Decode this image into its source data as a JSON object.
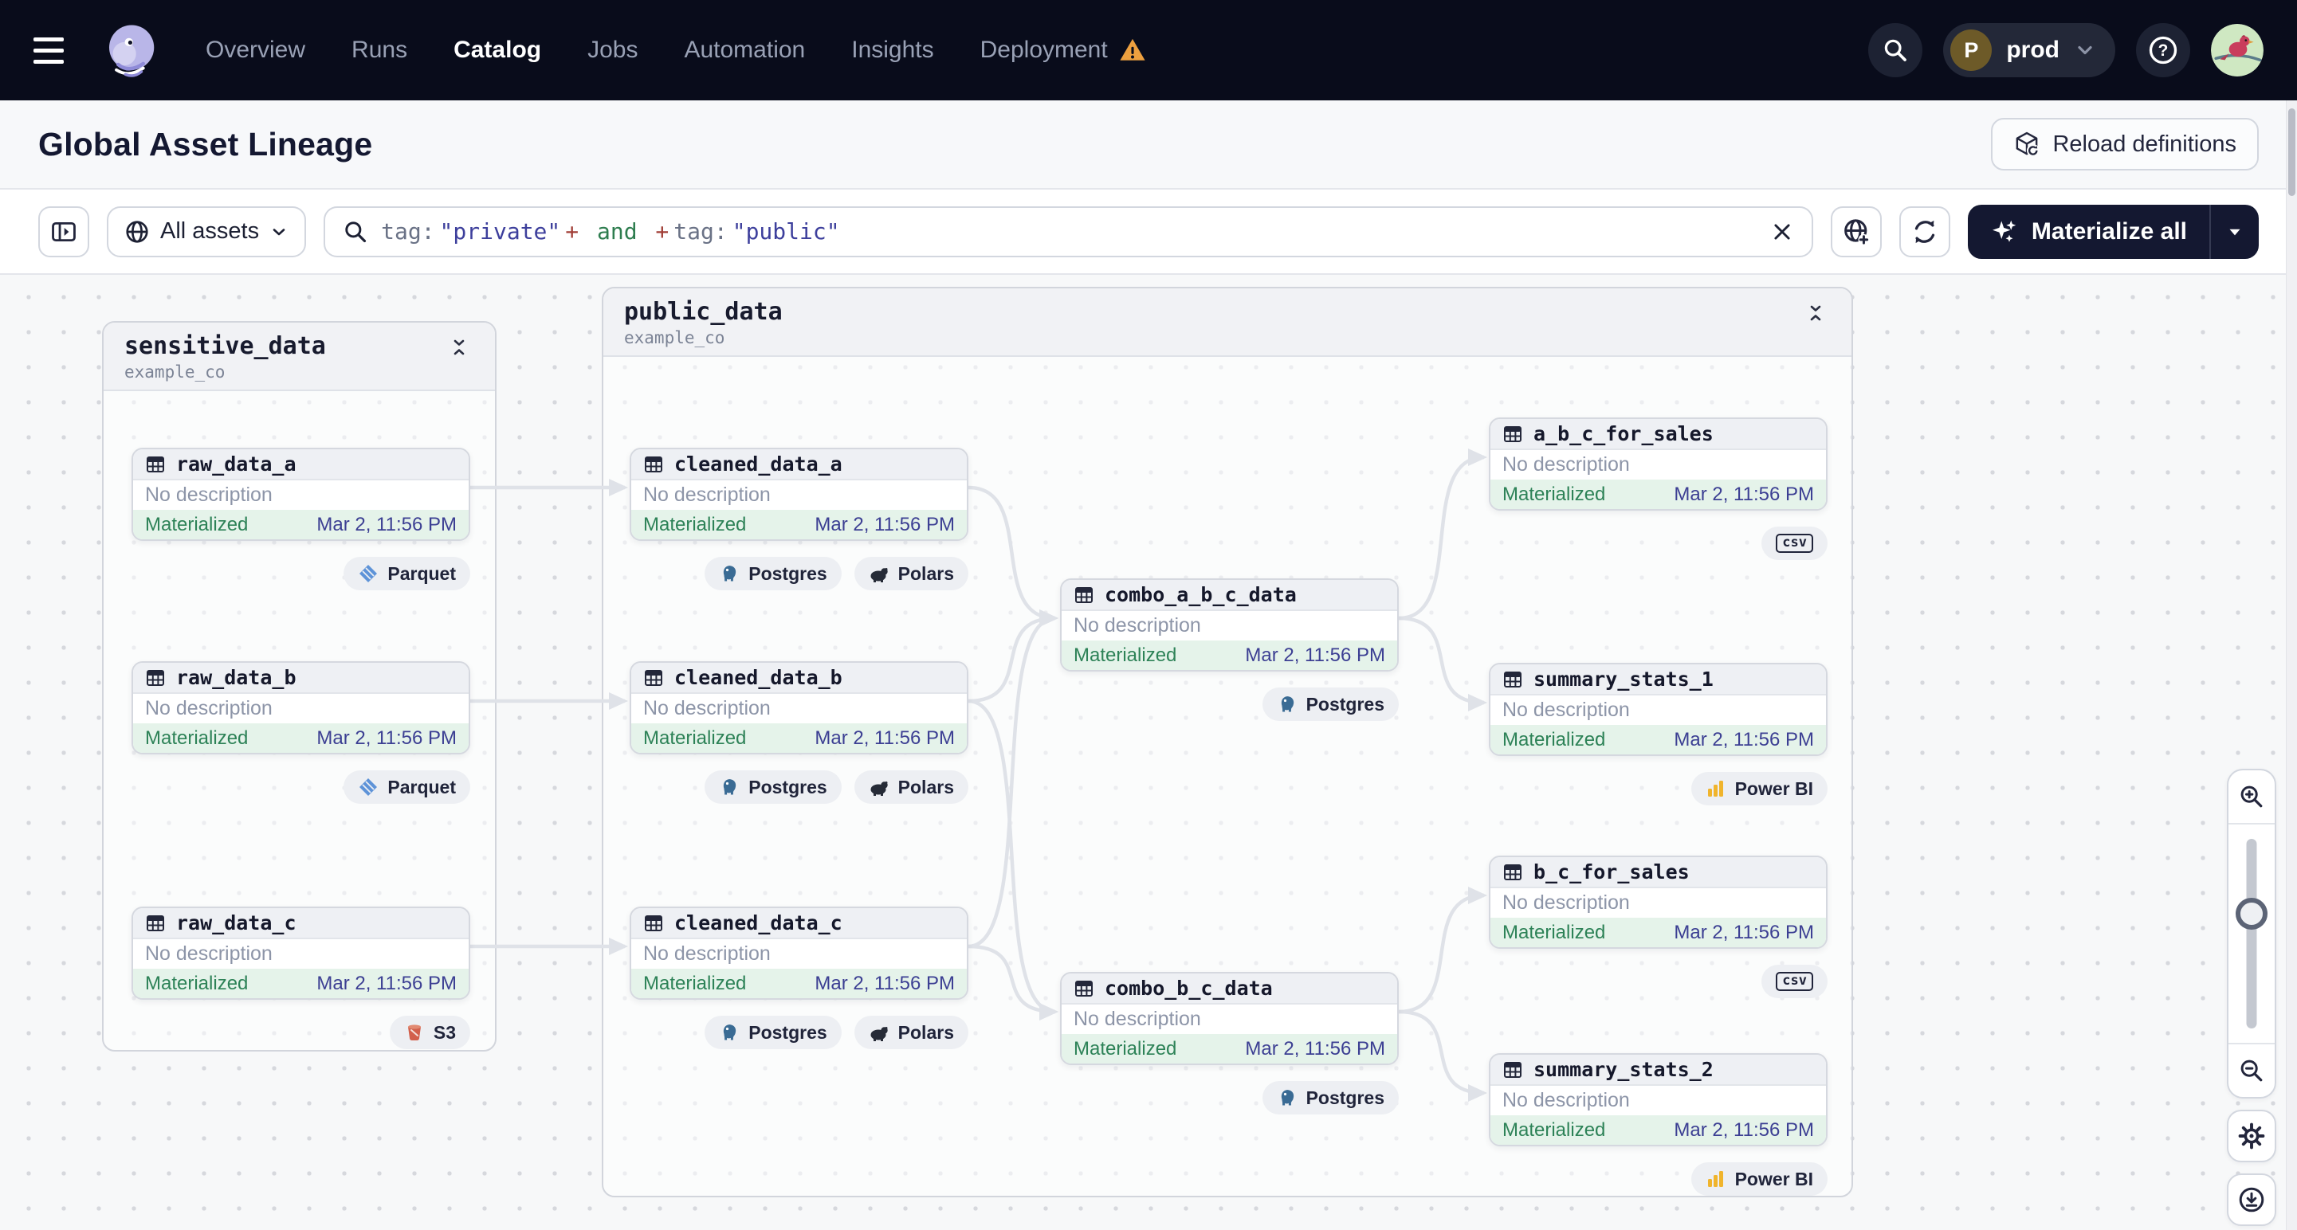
{
  "nav": {
    "brand": "Dagster",
    "items": [
      {
        "label": "Overview"
      },
      {
        "label": "Runs"
      },
      {
        "label": "Catalog",
        "active": true
      },
      {
        "label": "Jobs"
      },
      {
        "label": "Automation"
      },
      {
        "label": "Insights"
      },
      {
        "label": "Deployment",
        "warning": true
      }
    ],
    "environment": {
      "initial": "P",
      "name": "prod"
    }
  },
  "header": {
    "title": "Global Asset Lineage",
    "reload_button": "Reload definitions"
  },
  "toolbar": {
    "scope_label": "All assets",
    "search": {
      "tokens": [
        {
          "text": "tag:",
          "kind": "key"
        },
        {
          "text": "\"private\"",
          "kind": "str"
        },
        {
          "text": "+",
          "kind": "op"
        },
        {
          "text": " and ",
          "kind": "bool"
        },
        {
          "text": "+",
          "kind": "op"
        },
        {
          "text": "tag:",
          "kind": "key"
        },
        {
          "text": "\"public\"",
          "kind": "str"
        }
      ]
    },
    "materialize_label": "Materialize all"
  },
  "graph": {
    "groups": [
      {
        "name": "sensitive_data",
        "subtitle": "example_co",
        "nodes": [
          {
            "id": "raw_data_a",
            "title": "raw_data_a",
            "description": "No description",
            "status": "Materialized",
            "timestamp": "Mar 2, 11:56 PM",
            "badges": [
              {
                "icon": "parquet-icon",
                "label": "Parquet"
              }
            ]
          },
          {
            "id": "raw_data_b",
            "title": "raw_data_b",
            "description": "No description",
            "status": "Materialized",
            "timestamp": "Mar 2, 11:56 PM",
            "badges": [
              {
                "icon": "parquet-icon",
                "label": "Parquet"
              }
            ]
          },
          {
            "id": "raw_data_c",
            "title": "raw_data_c",
            "description": "No description",
            "status": "Materialized",
            "timestamp": "Mar 2, 11:56 PM",
            "badges": [
              {
                "icon": "s3-icon",
                "label": "S3"
              }
            ]
          }
        ]
      },
      {
        "name": "public_data",
        "subtitle": "example_co",
        "nodes": [
          {
            "id": "cleaned_data_a",
            "title": "cleaned_data_a",
            "description": "No description",
            "status": "Materialized",
            "timestamp": "Mar 2, 11:56 PM",
            "badges": [
              {
                "icon": "postgres-icon",
                "label": "Postgres"
              },
              {
                "icon": "polars-icon",
                "label": "Polars"
              }
            ]
          },
          {
            "id": "cleaned_data_b",
            "title": "cleaned_data_b",
            "description": "No description",
            "status": "Materialized",
            "timestamp": "Mar 2, 11:56 PM",
            "badges": [
              {
                "icon": "postgres-icon",
                "label": "Postgres"
              },
              {
                "icon": "polars-icon",
                "label": "Polars"
              }
            ]
          },
          {
            "id": "cleaned_data_c",
            "title": "cleaned_data_c",
            "description": "No description",
            "status": "Materialized",
            "timestamp": "Mar 2, 11:56 PM",
            "badges": [
              {
                "icon": "postgres-icon",
                "label": "Postgres"
              },
              {
                "icon": "polars-icon",
                "label": "Polars"
              }
            ]
          },
          {
            "id": "combo_a_b_c_data",
            "title": "combo_a_b_c_data",
            "description": "No description",
            "status": "Materialized",
            "timestamp": "Mar 2, 11:56 PM",
            "badges": [
              {
                "icon": "postgres-icon",
                "label": "Postgres"
              }
            ]
          },
          {
            "id": "combo_b_c_data",
            "title": "combo_b_c_data",
            "description": "No description",
            "status": "Materialized",
            "timestamp": "Mar 2, 11:56 PM",
            "badges": [
              {
                "icon": "postgres-icon",
                "label": "Postgres"
              }
            ]
          },
          {
            "id": "a_b_c_for_sales",
            "title": "a_b_c_for_sales",
            "description": "No description",
            "status": "Materialized",
            "timestamp": "Mar 2, 11:56 PM",
            "badges": [
              {
                "icon": "csv-icon",
                "label": "csv"
              }
            ]
          },
          {
            "id": "summary_stats_1",
            "title": "summary_stats_1",
            "description": "No description",
            "status": "Materialized",
            "timestamp": "Mar 2, 11:56 PM",
            "badges": [
              {
                "icon": "powerbi-icon",
                "label": "Power BI"
              }
            ]
          },
          {
            "id": "b_c_for_sales",
            "title": "b_c_for_sales",
            "description": "No description",
            "status": "Materialized",
            "timestamp": "Mar 2, 11:56 PM",
            "badges": [
              {
                "icon": "csv-icon",
                "label": "csv"
              }
            ]
          },
          {
            "id": "summary_stats_2",
            "title": "summary_stats_2",
            "description": "No description",
            "status": "Materialized",
            "timestamp": "Mar 2, 11:56 PM",
            "badges": [
              {
                "icon": "powerbi-icon",
                "label": "Power BI"
              }
            ]
          }
        ]
      }
    ],
    "edges": [
      {
        "from": "raw_data_a",
        "to": "cleaned_data_a"
      },
      {
        "from": "raw_data_b",
        "to": "cleaned_data_b"
      },
      {
        "from": "raw_data_c",
        "to": "cleaned_data_c"
      },
      {
        "from": "cleaned_data_a",
        "to": "combo_a_b_c_data"
      },
      {
        "from": "cleaned_data_b",
        "to": "combo_a_b_c_data"
      },
      {
        "from": "cleaned_data_c",
        "to": "combo_a_b_c_data"
      },
      {
        "from": "cleaned_data_b",
        "to": "combo_b_c_data"
      },
      {
        "from": "cleaned_data_c",
        "to": "combo_b_c_data"
      },
      {
        "from": "combo_a_b_c_data",
        "to": "a_b_c_for_sales"
      },
      {
        "from": "combo_a_b_c_data",
        "to": "summary_stats_1"
      },
      {
        "from": "combo_b_c_data",
        "to": "b_c_for_sales"
      },
      {
        "from": "combo_b_c_data",
        "to": "summary_stats_2"
      }
    ]
  },
  "colors": {
    "nav_bg": "#090c1b",
    "warning_orange": "#eda03f",
    "materialize_bg": "#141831",
    "status_green": "#2d8257",
    "status_green_bg": "#e5f3ea",
    "timestamp_indigo": "#3c3f93",
    "edge_gray": "#dfe2e8",
    "accent_purple": "#b9b6e8"
  }
}
